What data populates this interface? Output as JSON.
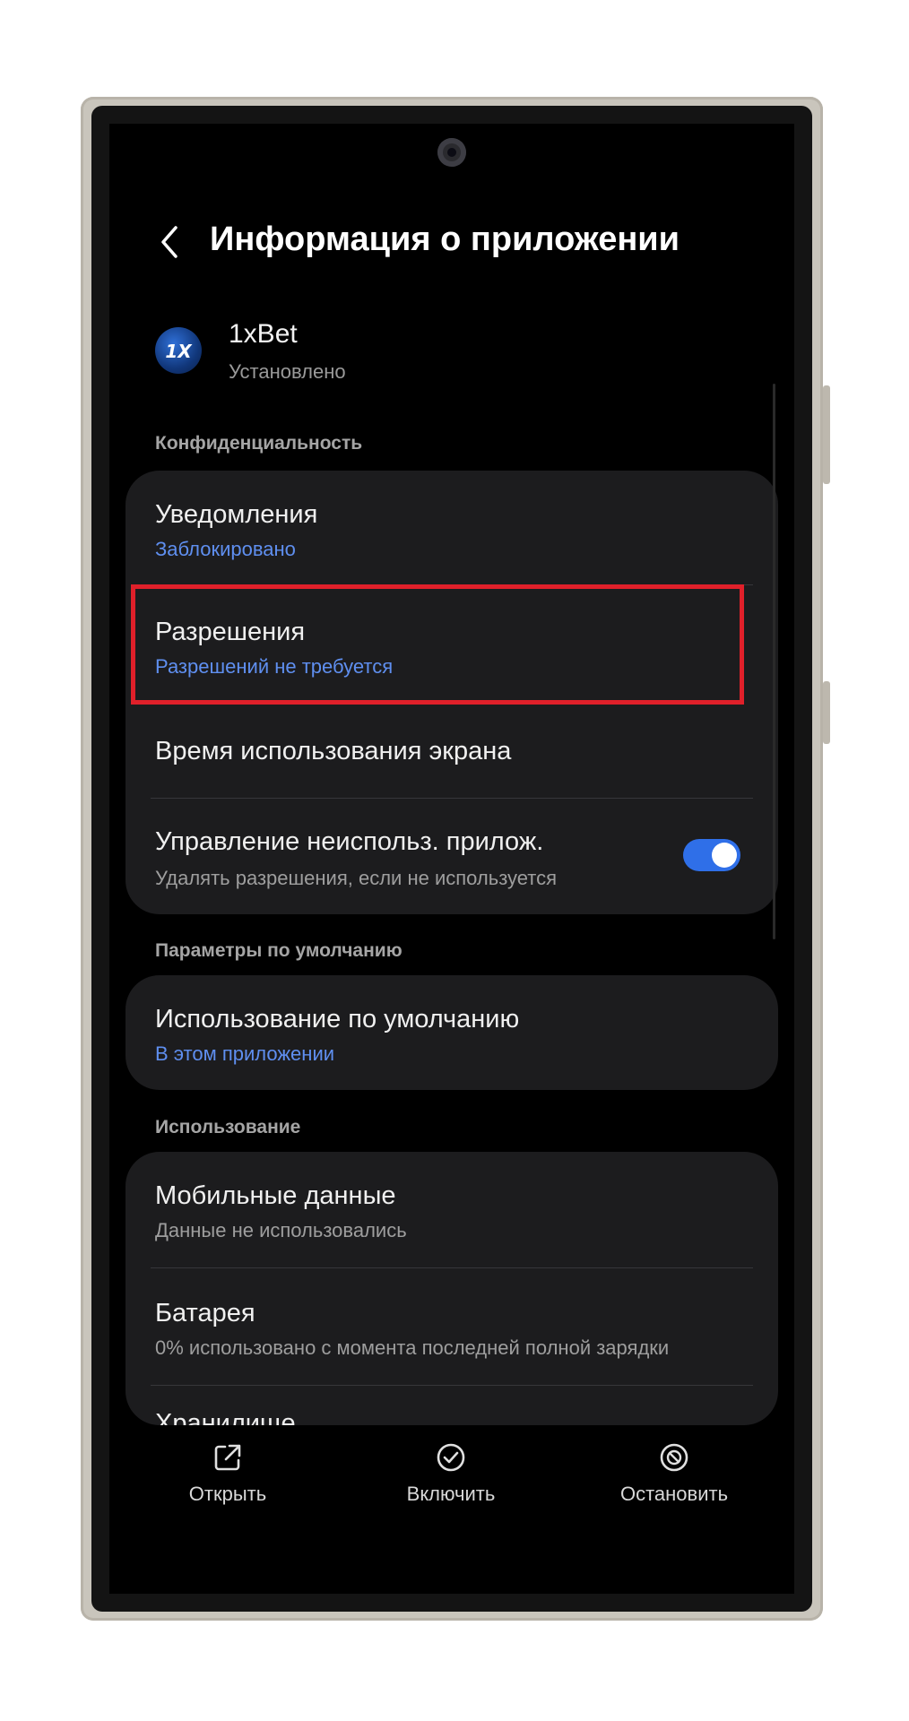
{
  "header": {
    "title": "Информация о приложении"
  },
  "app": {
    "name": "1xBet",
    "status": "Установлено",
    "icon_text": "1X"
  },
  "sections": {
    "privacy": "Конфиденциальность",
    "defaults": "Параметры по умолчанию",
    "usage": "Использование"
  },
  "privacy_items": [
    {
      "title": "Уведомления",
      "subtitle": "Заблокировано"
    },
    {
      "title": "Разрешения",
      "subtitle": "Разрешений не требуется"
    },
    {
      "title": "Время использования экрана"
    },
    {
      "title": "Управление неиспольз. прилож.",
      "subtitle": "Удалять разрешения, если не используется",
      "toggle_on": true
    }
  ],
  "defaults_items": [
    {
      "title": "Использование по умолчанию",
      "subtitle": "В этом приложении"
    }
  ],
  "usage_items": [
    {
      "title": "Мобильные данные",
      "subtitle": "Данные не использовались"
    },
    {
      "title": "Батарея",
      "subtitle": "0% использовано с момента последней полной зарядки"
    },
    {
      "title": "Хранилище"
    }
  ],
  "bottom_nav": {
    "open": "Открыть",
    "enable": "Включить",
    "stop": "Остановить"
  },
  "colors": {
    "accent": "#2f6fe8",
    "link": "#5f8ff0",
    "highlight": "#e0202a",
    "card": "#1c1c1e"
  }
}
